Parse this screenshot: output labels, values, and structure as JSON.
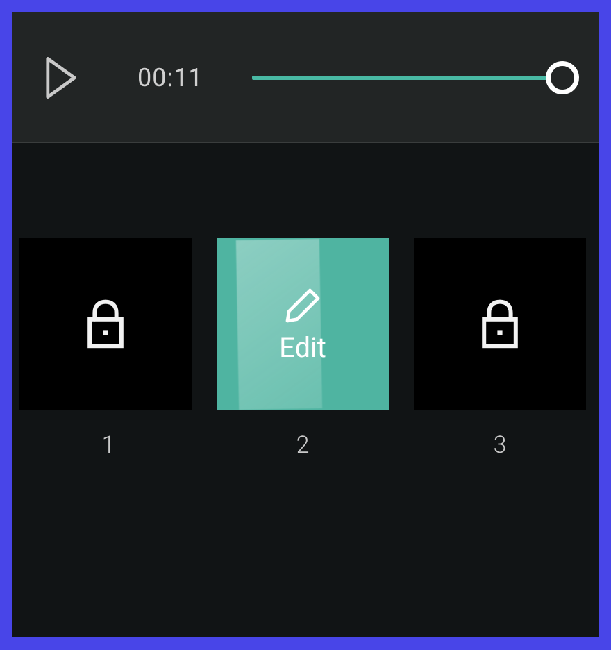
{
  "player": {
    "timecode": "00:11",
    "progress_percent": 100
  },
  "tiles": {
    "edit_label": "Edit",
    "items": [
      {
        "number": "1",
        "state": "locked"
      },
      {
        "number": "2",
        "state": "active"
      },
      {
        "number": "3",
        "state": "locked"
      }
    ]
  },
  "colors": {
    "frame": "#4845e8",
    "accent": "#4fb4a1"
  }
}
